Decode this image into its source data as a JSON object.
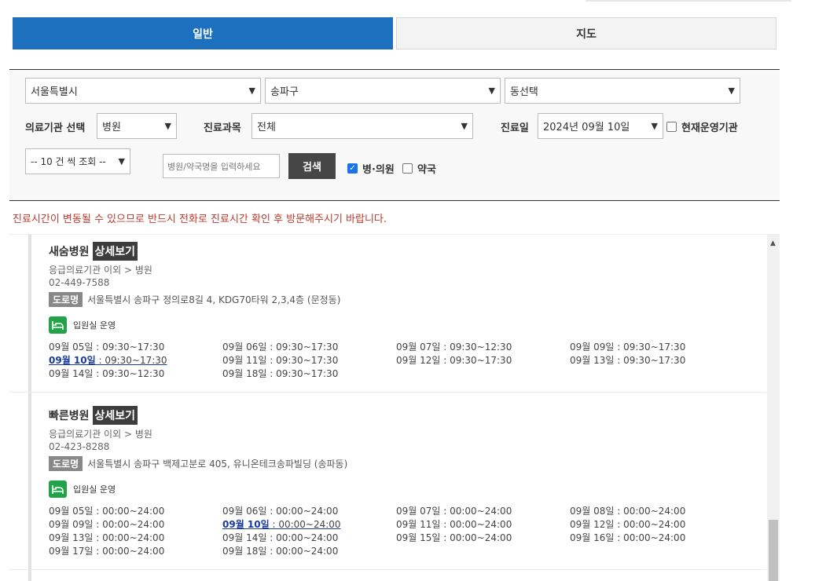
{
  "tabs": {
    "general": "일반",
    "map": "지도"
  },
  "filters": {
    "city": "서울특별시",
    "district": "송파구",
    "dong": "동선택",
    "institution_label": "의료기관 선택",
    "institution": "병원",
    "department_label": "진료과목",
    "department": "전체",
    "date_label": "진료일",
    "date": "2024년 09월 10일",
    "operating_label": "현재운영기관",
    "page_size": "-- 10 건 씩 조회 --",
    "search_placeholder": "병원/약국명을 입력하세요",
    "search_button": "검색",
    "hospital_check": "병·의원",
    "pharmacy_check": "약국"
  },
  "notice": "진료시간이 변동될 수 있으므로 반드시 전화로 진료시간 확인 후 방문해주시기 바랍니다.",
  "road_tag": "도로명",
  "detail_label": "상세보기",
  "ward_label": "입원실 운영",
  "hospitals": [
    {
      "name": "새숨병원",
      "category": "응급의료기관 이외 > 병원",
      "phone": "02-449-7588",
      "address": "서울특별시 송파구 정의로8길 4, KDG70타워 2,3,4층 (문정동)",
      "schedule": [
        {
          "date": "09월 05일",
          "time": " : 09:30~17:30",
          "style": "normal"
        },
        {
          "date": "09월 06일",
          "time": " : 09:30~17:30",
          "style": "normal"
        },
        {
          "date": "09월 07일",
          "time": " : 09:30~12:30",
          "style": "normal"
        },
        {
          "date": "09월 09일",
          "time": " : 09:30~17:30",
          "style": "normal"
        },
        {
          "date": "09월 10일",
          "time": " : 09:30~17:30",
          "style": "today"
        },
        {
          "date": "09월 11일",
          "time": " : 09:30~17:30",
          "style": "normal"
        },
        {
          "date": "09월 12일",
          "time": " : 09:30~17:30",
          "style": "normal"
        },
        {
          "date": "09월 13일",
          "time": " : 09:30~17:30",
          "style": "normal"
        },
        {
          "date": "09월 14일",
          "time": " : 09:30~12:30",
          "style": "red"
        },
        {
          "date": "09월 18일",
          "time": " : 09:30~17:30",
          "style": "red"
        }
      ]
    },
    {
      "name": "빠른병원",
      "category": "응급의료기관 이외 > 병원",
      "phone": "02-423-8288",
      "address": "서울특별시 송파구 백제고분로 405, 유니온테크송파빌딩 (송파동)",
      "schedule": [
        {
          "date": "09월 05일",
          "time": " : 00:00~24:00",
          "style": "normal"
        },
        {
          "date": "09월 06일",
          "time": " : 00:00~24:00",
          "style": "normal"
        },
        {
          "date": "09월 07일",
          "time": " : 00:00~24:00",
          "style": "normal"
        },
        {
          "date": "09월 08일",
          "time": " : 00:00~24:00",
          "style": "normal"
        },
        {
          "date": "09월 09일",
          "time": " : 00:00~24:00",
          "style": "normal"
        },
        {
          "date": "09월 10일",
          "time": " : 00:00~24:00",
          "style": "today"
        },
        {
          "date": "09월 11일",
          "time": " : 00:00~24:00",
          "style": "normal"
        },
        {
          "date": "09월 12일",
          "time": " : 00:00~24:00",
          "style": "normal"
        },
        {
          "date": "09월 13일",
          "time": " : 00:00~24:00",
          "style": "normal"
        },
        {
          "date": "09월 14일",
          "time": " : 00:00~24:00",
          "style": "red"
        },
        {
          "date": "09월 15일",
          "time": " : 00:00~24:00",
          "style": "red"
        },
        {
          "date": "09월 16일",
          "time": " : 00:00~24:00",
          "style": "red"
        },
        {
          "date": "09월 17일",
          "time": " : 00:00~24:00",
          "style": "red"
        },
        {
          "date": "09월 18일",
          "time": " : 00:00~24:00",
          "style": "red"
        }
      ]
    }
  ],
  "colors": {
    "primary": "#1c70bd",
    "alert": "#c62828",
    "ward_icon": "#24a24a"
  },
  "icons": {
    "select": "chevron-down-icon",
    "ward": "bed-icon",
    "scroll": "scroll-up-arrow-icon"
  }
}
